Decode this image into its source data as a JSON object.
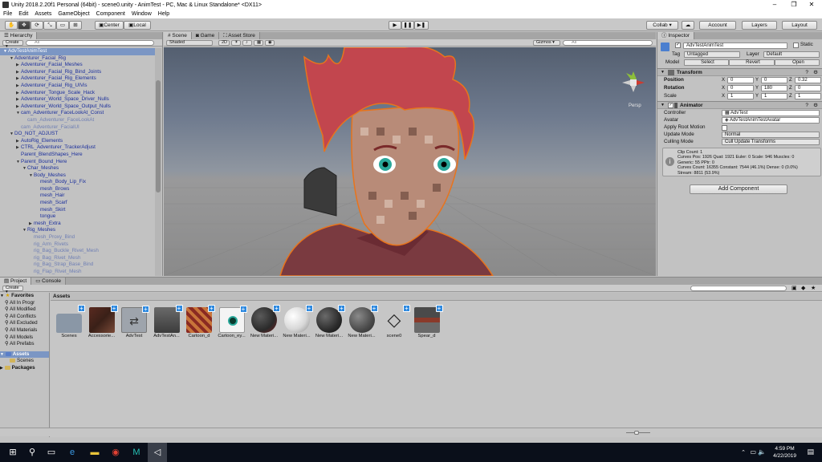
{
  "window": {
    "title": "Unity 2018.2.20f1 Personal (64bit) - scene0.unity - AnimTest - PC, Mac & Linux Standalone* <DX11>",
    "controls": [
      "–",
      "❐",
      "✕"
    ]
  },
  "menu": [
    "File",
    "Edit",
    "Assets",
    "GameObject",
    "Component",
    "Window",
    "Help"
  ],
  "toolbar": {
    "pivot": "Center",
    "space": "Local",
    "collab": "Collab ▾",
    "account": "Account",
    "layers": "Layers",
    "layout": "Layout"
  },
  "hierarchy": {
    "tab": "Hierarchy",
    "create": "Create ▾",
    "search_placeholder": "All",
    "rows": [
      {
        "text": "AdvTestAnimTest",
        "indent": 1,
        "arrow": "▼",
        "style": "sel"
      },
      {
        "text": "Adventurer_Facial_Rig",
        "indent": 2,
        "arrow": "▼",
        "style": ""
      },
      {
        "text": "Adventurer_Facial_Meshes",
        "indent": 3,
        "arrow": "▶",
        "style": ""
      },
      {
        "text": "Adventurer_Facial_Rig_Bind_Joints",
        "indent": 3,
        "arrow": "▶",
        "style": ""
      },
      {
        "text": "Adventurer_Facial_Rig_Elements",
        "indent": 3,
        "arrow": "▶",
        "style": ""
      },
      {
        "text": "Adventurer_Facial_Rig_UIVis",
        "indent": 3,
        "arrow": "▶",
        "style": ""
      },
      {
        "text": "Adventurer_Tongue_Scale_Hack",
        "indent": 3,
        "arrow": "▶",
        "style": ""
      },
      {
        "text": "Adventurer_World_Space_Driver_Nulls",
        "indent": 3,
        "arrow": "▶",
        "style": ""
      },
      {
        "text": "Adventurer_World_Space_Output_Nulls",
        "indent": 3,
        "arrow": "▶",
        "style": ""
      },
      {
        "text": "cam_Adventurer_FaceLookAt_Const",
        "indent": 3,
        "arrow": "▼",
        "style": ""
      },
      {
        "text": "cam_Adventurer_FaceLookAt",
        "indent": 4,
        "arrow": "",
        "style": "dim"
      },
      {
        "text": "cam_Adventurer_FacialUI",
        "indent": 3,
        "arrow": "",
        "style": "dim"
      },
      {
        "text": "DO_NOT_ADJUST",
        "indent": 2,
        "arrow": "▼",
        "style": ""
      },
      {
        "text": "AutoRig_Elements",
        "indent": 3,
        "arrow": "▶",
        "style": ""
      },
      {
        "text": "CTRL_Adventurer_TrackerAdjust",
        "indent": 3,
        "arrow": "▶",
        "style": ""
      },
      {
        "text": "Parent_BlendShapes_Here",
        "indent": 3,
        "arrow": "",
        "style": ""
      },
      {
        "text": "Parent_Bound_Here",
        "indent": 3,
        "arrow": "▼",
        "style": ""
      },
      {
        "text": "Char_Meshes",
        "indent": 4,
        "arrow": "▼",
        "style": ""
      },
      {
        "text": "Body_Meshes",
        "indent": 5,
        "arrow": "▼",
        "style": ""
      },
      {
        "text": "mesh_Body_Lip_Fix",
        "indent": 6,
        "arrow": "",
        "style": ""
      },
      {
        "text": "mesh_Brows",
        "indent": 6,
        "arrow": "",
        "style": ""
      },
      {
        "text": "mesh_Hair",
        "indent": 6,
        "arrow": "",
        "style": ""
      },
      {
        "text": "mesh_Scarf",
        "indent": 6,
        "arrow": "",
        "style": ""
      },
      {
        "text": "mesh_Skirt",
        "indent": 6,
        "arrow": "",
        "style": ""
      },
      {
        "text": "tongue",
        "indent": 6,
        "arrow": "",
        "style": ""
      },
      {
        "text": "mesh_Extra",
        "indent": 5,
        "arrow": "▶",
        "style": ""
      },
      {
        "text": "Rig_Meshes",
        "indent": 4,
        "arrow": "▼",
        "style": ""
      },
      {
        "text": "mesh_Proxy_Bind",
        "indent": 5,
        "arrow": "",
        "style": "dim"
      },
      {
        "text": "rig_Arm_Rivets",
        "indent": 5,
        "arrow": "",
        "style": "dim"
      },
      {
        "text": "rig_Bag_Buckle_Rivet_Mesh",
        "indent": 5,
        "arrow": "",
        "style": "dim"
      },
      {
        "text": "rig_Bag_Rivet_Mesh",
        "indent": 5,
        "arrow": "",
        "style": "dim"
      },
      {
        "text": "rig_Bag_Strap_Base_Bind",
        "indent": 5,
        "arrow": "",
        "style": "dim"
      },
      {
        "text": "rig_Flap_Rivet_Mesh",
        "indent": 5,
        "arrow": "",
        "style": "dim"
      }
    ]
  },
  "scene": {
    "tabs": [
      "Scene",
      "Game",
      "Asset Store"
    ],
    "shading": "Shaded",
    "mode_2d": "2D",
    "gizmos": "Gizmos ▾",
    "search_placeholder": "All",
    "persp": "Persp"
  },
  "inspector": {
    "tab": "Inspector",
    "object_name": "AdvTestAnimTest",
    "static_label": "Static",
    "tag_label": "Tag",
    "tag_value": "Untagged",
    "layer_label": "Layer",
    "layer_value": "Default",
    "model_label": "Model",
    "model_buttons": [
      "Select",
      "Revert",
      "Open"
    ],
    "transform": {
      "title": "Transform",
      "position_label": "Position",
      "rotation_label": "Rotation",
      "scale_label": "Scale",
      "axis_x": "X",
      "axis_y": "Y",
      "axis_z": "Z",
      "position": {
        "x": "0",
        "y": "0",
        "z": "0.32"
      },
      "rotation": {
        "x": "0",
        "y": "180",
        "z": "0"
      },
      "scale": {
        "x": "1",
        "y": "1",
        "z": "1"
      }
    },
    "animator": {
      "title": "Animator",
      "controller_label": "Controller",
      "controller_value": "AdvTest",
      "avatar_label": "Avatar",
      "avatar_value": "AdvTestAnimTestAvatar",
      "apply_root_motion_label": "Apply Root Motion",
      "update_mode_label": "Update Mode",
      "update_mode_value": "Normal",
      "culling_mode_label": "Culling Mode",
      "culling_mode_value": "Cull Update Transforms",
      "info": [
        "Clip Count: 1",
        "Curves Pos: 1926 Quat: 1921 Euler: 0 Scale: 946 Muscles: 0",
        "Generic: 55 PPtr: 0",
        "Curves Count: 16355 Constant: 7544 (46.1%) Dense: 0 (0.0%)",
        "Stream: 8811 (53.9%)"
      ]
    },
    "add_component": "Add Component"
  },
  "project": {
    "tabs": [
      "Project",
      "Console"
    ],
    "create": "Create ▾",
    "favorites_label": "Favorites",
    "favorites": [
      "All In Progr",
      "All Modified",
      "All Conflicts",
      "All Excluded",
      "All Materials",
      "All Models",
      "All Prefabs"
    ],
    "assets_label": "Assets",
    "assets_children": [
      "Scenes"
    ],
    "packages_label": "Packages",
    "breadcrumb": "Assets",
    "items": [
      {
        "name": "Scenes",
        "kind": "folder"
      },
      {
        "name": "Accessorie...",
        "kind": "texture-dark"
      },
      {
        "name": "AdvTest",
        "kind": "controller"
      },
      {
        "name": "AdvTestAn...",
        "kind": "model"
      },
      {
        "name": "Cartoon_d",
        "kind": "texture-red"
      },
      {
        "name": "Cartoon_ey...",
        "kind": "texture-eye"
      },
      {
        "name": "New Materi...",
        "kind": "mat-red"
      },
      {
        "name": "New Materi...",
        "kind": "mat-white"
      },
      {
        "name": "New Materi...",
        "kind": "mat-dark"
      },
      {
        "name": "New Materi...",
        "kind": "mat-grey"
      },
      {
        "name": "scene0",
        "kind": "unity"
      },
      {
        "name": "Spear_d",
        "kind": "texture-spear"
      }
    ]
  },
  "taskbar": {
    "time": "4:59 PM",
    "date": "4/22/2019"
  }
}
